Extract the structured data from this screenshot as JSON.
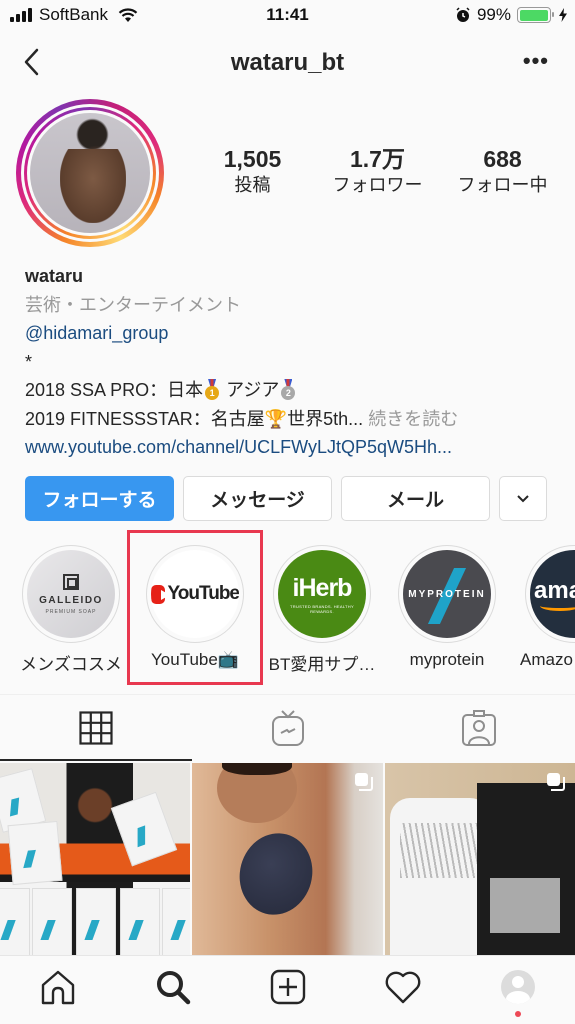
{
  "status_bar": {
    "carrier": "SoftBank",
    "time": "11:41",
    "battery_percent": "99%",
    "battery_level": 0.99,
    "icons": [
      "signal-icon",
      "wifi-icon",
      "alarm-icon",
      "battery-icon",
      "charging-icon"
    ]
  },
  "header": {
    "username": "wataru_bt",
    "back_icon": "chevron-left-icon",
    "more_label": "•••"
  },
  "profile": {
    "has_story_ring": true,
    "stats": [
      {
        "value": "1,505",
        "label": "投稿"
      },
      {
        "value": "1.7万",
        "label": "フォロワー"
      },
      {
        "value": "688",
        "label": "フォロー中"
      }
    ],
    "display_name": "wataru",
    "category": "芸術・エンターテイメント",
    "mention": "@hidamari_group",
    "bio_line1": "*",
    "bio_line2_a": "2018 SSA PRO：日本",
    "bio_line2_medal1": "1",
    "bio_line2_b": "アジア",
    "bio_line2_medal2": "2",
    "bio_line3_a": "2019 FITNESSSTAR：名古屋",
    "bio_line3_trophy": "🏆",
    "bio_line3_b": "世界5th...",
    "read_more": "続きを読む",
    "website": "www.youtube.com/channel/UCLFWyLJtQP5qW5Hh..."
  },
  "actions": {
    "follow": "フォローする",
    "message": "メッセージ",
    "mail": "メール",
    "more_icon": "chevron-down-icon"
  },
  "highlights": [
    {
      "label": "メンズコスメ",
      "cover_title": "GALLEIDO",
      "cover_subtitle": "PREMIUM SOAP"
    },
    {
      "label": "YouTube📺",
      "cover_title": "YouTube",
      "highlighted": true
    },
    {
      "label": "BT愛用サプ…",
      "cover_title": "iHerb",
      "cover_subtitle": "TRUSTED BRANDS. HEALTHY REWARDS."
    },
    {
      "label": "myprotein",
      "cover_title": "MYPROTEIN"
    },
    {
      "label": "Amazo",
      "cover_title": "ama"
    }
  ],
  "tabs": [
    {
      "name": "grid",
      "icon": "grid-icon",
      "active": true
    },
    {
      "name": "igtv",
      "icon": "igtv-icon",
      "active": false
    },
    {
      "name": "tagged",
      "icon": "tagged-icon",
      "active": false
    }
  ],
  "posts": [
    {
      "description": "Man holding Protein Pancake Mix bags",
      "multi": false
    },
    {
      "description": "Man holding dark round soap",
      "multi": true
    },
    {
      "description": "Man in superhero print T-shirt with MYPROTEIN box",
      "multi": true
    }
  ],
  "bottom_nav": [
    {
      "name": "home",
      "icon": "home-icon"
    },
    {
      "name": "search",
      "icon": "search-icon"
    },
    {
      "name": "new-post",
      "icon": "plus-square-icon"
    },
    {
      "name": "activity",
      "icon": "heart-icon"
    },
    {
      "name": "profile",
      "icon": "profile-avatar-icon",
      "notification_dot": true
    }
  ],
  "colors": {
    "primary_blue": "#3897f0",
    "link_blue": "#1b4c80",
    "highlight_box_red": "#e8384f",
    "battery_green": "#4cd964",
    "notification_red": "#ed4956"
  }
}
